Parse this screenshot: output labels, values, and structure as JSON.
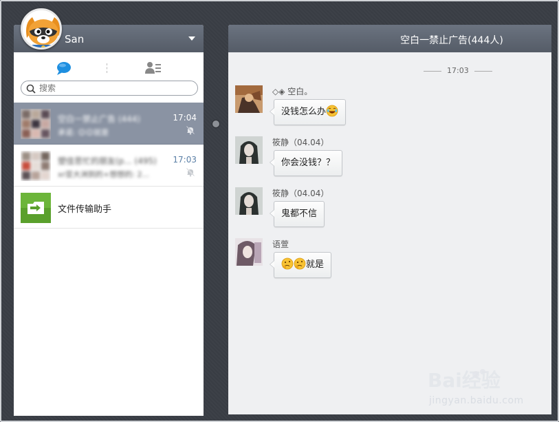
{
  "user": {
    "name": "San"
  },
  "search": {
    "placeholder": "搜索"
  },
  "conversations": [
    {
      "title": "空白一禁止广告 (444)",
      "preview": "承诺: 😊😊就是",
      "time": "17:04",
      "active": true,
      "muted": true
    },
    {
      "title": "塑佳思忙的朋友(p... (495)",
      "preview": "xr亚大洲到的+想想的: 2...",
      "time": "17:03",
      "active": false,
      "muted": true
    },
    {
      "title": "文件传输助手",
      "active": false
    }
  ],
  "chat": {
    "title": "空白一禁止广告(444人)",
    "time_divider": "17:03",
    "messages": [
      {
        "sender": "◇◈ 空白。",
        "text": "没钱怎么办"
      },
      {
        "sender": "筱静（04.04）",
        "text": "你会没钱？？"
      },
      {
        "sender": "筱静（04.04）",
        "text": "鬼都不信"
      },
      {
        "sender": "语萱",
        "text": "就是"
      }
    ]
  },
  "watermark": {
    "text": "jingyan.baidu.com",
    "logo": "Bai经验"
  },
  "colors": {
    "header": "#5f6772",
    "active_item": "#8a93a3",
    "accent": "#1e8fe0",
    "time": "#5a7fa6"
  },
  "icons": [
    "avatar-raccoon",
    "chat-bubble-icon",
    "contacts-icon",
    "search-icon",
    "mute-bell-icon",
    "file-transfer-icon",
    "dropdown-arrow-icon",
    "emoji-laugh-icon",
    "emoji-think-icon"
  ]
}
